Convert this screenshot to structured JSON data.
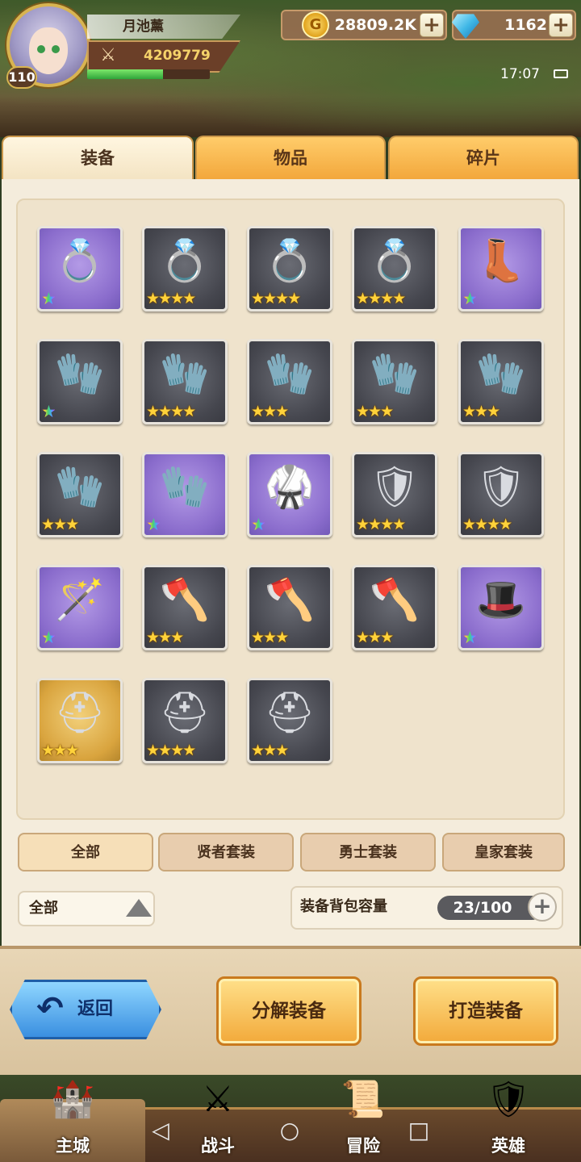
{
  "player": {
    "name": "月池薰",
    "level": "110",
    "power": "4209779",
    "exp_fraction": 0.62
  },
  "currency": {
    "gold": "28809.2K",
    "gems": "1162",
    "plus": "+"
  },
  "status": {
    "time": "17:07"
  },
  "tabs": [
    "装备",
    "物品",
    "碎片"
  ],
  "items": [
    {
      "icon": "ring-icon",
      "glyph": "💍",
      "bg": "purple",
      "stars": "★",
      "rainbow": true
    },
    {
      "icon": "ring-icon",
      "glyph": "💍",
      "bg": "grey",
      "stars": "★★★★",
      "rainbow": false
    },
    {
      "icon": "ring-icon",
      "glyph": "💍",
      "bg": "grey",
      "stars": "★★★★",
      "rainbow": false
    },
    {
      "icon": "ring-icon",
      "glyph": "💍",
      "bg": "grey",
      "stars": "★★★★",
      "rainbow": false
    },
    {
      "icon": "boots-icon",
      "glyph": "👢",
      "bg": "purple",
      "stars": "★",
      "rainbow": true
    },
    {
      "icon": "gauntlets-icon",
      "glyph": "🧤",
      "bg": "grey",
      "stars": "★",
      "rainbow": true
    },
    {
      "icon": "gauntlets-icon",
      "glyph": "🧤",
      "bg": "grey",
      "stars": "★★★★",
      "rainbow": false
    },
    {
      "icon": "gauntlets-icon",
      "glyph": "🧤",
      "bg": "grey",
      "stars": "★★★",
      "rainbow": false
    },
    {
      "icon": "gauntlets-icon",
      "glyph": "🧤",
      "bg": "grey",
      "stars": "★★★",
      "rainbow": false
    },
    {
      "icon": "gauntlets-icon",
      "glyph": "🧤",
      "bg": "grey",
      "stars": "★★★",
      "rainbow": false
    },
    {
      "icon": "gauntlets-icon",
      "glyph": "🧤",
      "bg": "grey",
      "stars": "★★★",
      "rainbow": false
    },
    {
      "icon": "gloves-icon",
      "glyph": "🧤",
      "bg": "purple",
      "stars": "★",
      "rainbow": true
    },
    {
      "icon": "robe-icon",
      "glyph": "🥋",
      "bg": "purple",
      "stars": "★",
      "rainbow": true
    },
    {
      "icon": "chest-armor-icon",
      "glyph": "🛡",
      "bg": "grey",
      "stars": "★★★★",
      "rainbow": false
    },
    {
      "icon": "chest-armor-icon",
      "glyph": "🛡",
      "bg": "grey",
      "stars": "★★★★",
      "rainbow": false
    },
    {
      "icon": "staff-icon",
      "glyph": "🪄",
      "bg": "purple",
      "stars": "★",
      "rainbow": true
    },
    {
      "icon": "axe-icon",
      "glyph": "🪓",
      "bg": "grey",
      "stars": "★★★",
      "rainbow": false
    },
    {
      "icon": "axe-icon",
      "glyph": "🪓",
      "bg": "grey",
      "stars": "★★★",
      "rainbow": false
    },
    {
      "icon": "axe-icon",
      "glyph": "🪓",
      "bg": "grey",
      "stars": "★★★",
      "rainbow": false
    },
    {
      "icon": "wizard-hat-icon",
      "glyph": "🎩",
      "bg": "purple",
      "stars": "★",
      "rainbow": true
    },
    {
      "icon": "helmet-icon",
      "glyph": "⛑",
      "bg": "gold",
      "stars": "★★★",
      "rainbow": false
    },
    {
      "icon": "helmet-icon",
      "glyph": "⛑",
      "bg": "grey",
      "stars": "★★★★",
      "rainbow": false
    },
    {
      "icon": "helmet-icon",
      "glyph": "⛑",
      "bg": "grey",
      "stars": "★★★",
      "rainbow": false
    }
  ],
  "filters": [
    "全部",
    "贤者套装",
    "勇士套装",
    "皇家套装"
  ],
  "dropdown": {
    "selected": "全部"
  },
  "capacity": {
    "label": "装备背包容量",
    "value": "23/100"
  },
  "actions": {
    "back": "返回",
    "decompose": "分解装备",
    "forge": "打造装备"
  },
  "nav": [
    "主城",
    "战斗",
    "冒险",
    "英雄"
  ],
  "colors": {
    "tab_active": "#f3e3c2",
    "tab_inactive": "#f2a63a",
    "back_button": "#3a8fe0",
    "action_button": "#f2a93a",
    "star_gold": "#ffd23a"
  }
}
